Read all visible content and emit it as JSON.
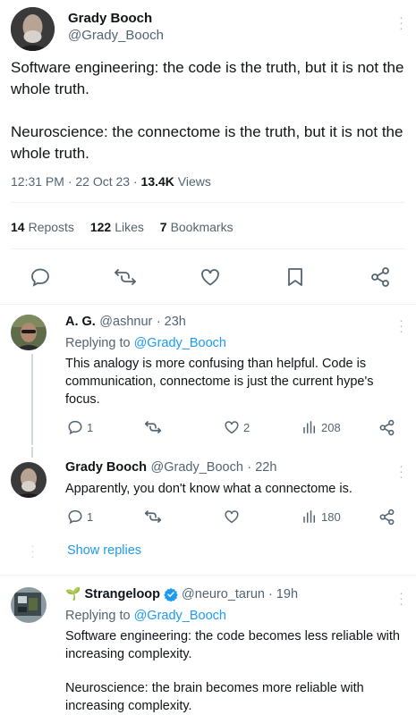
{
  "main_tweet": {
    "author_name": "Grady Booch",
    "author_handle": "@Grady_Booch",
    "paragraph_1": "Software engineering: the code is the truth, but it is not the whole truth.",
    "paragraph_2": "Neuroscience: the connectome is the truth, but it is not the whole truth.",
    "time": "12:31 PM",
    "date": "22 Oct 23",
    "views_count": "13.4K",
    "views_label": "Views",
    "reposts_count": "14",
    "reposts_label": "Reposts",
    "likes_count": "122",
    "likes_label": "Likes",
    "bookmarks_count": "7",
    "bookmarks_label": "Bookmarks",
    "separator": "·",
    "actions": [
      "reply-icon",
      "repost-icon",
      "like-icon",
      "bookmark-icon",
      "share-icon"
    ]
  },
  "replies": [
    {
      "author_name": "A. G.",
      "author_handle": "@ashnur",
      "time": "· 23h",
      "replying_label": "Replying to",
      "replying_to": "@Grady_Booch",
      "text": "This analogy is more confusing than helpful. Code is communication, connectome is just the current hype's focus.",
      "reply_count": "1",
      "like_count": "2",
      "views_count": "208"
    },
    {
      "author_name": "Grady Booch",
      "author_handle": "@Grady_Booch",
      "time": "· 22h",
      "text": "Apparently, you don't know what a connectome is.",
      "reply_count": "1",
      "views_count": "180",
      "show_replies": "Show replies"
    },
    {
      "emoji": "🌱",
      "author_name": "Strangeloop",
      "verified": true,
      "author_handle": "@neuro_tarun",
      "time": "· 19h",
      "replying_label": "Replying to",
      "replying_to": "@Grady_Booch",
      "text_1": "Software engineering: the code becomes less reliable with increasing complexity.",
      "text_2": "Neuroscience: the brain becomes more reliable with increasing complexity."
    }
  ],
  "colors": {
    "accent": "#1d9bf0",
    "text": "#0f1419",
    "muted": "#536471",
    "divider": "#eff3f4",
    "thread_line": "#cfd9de"
  }
}
